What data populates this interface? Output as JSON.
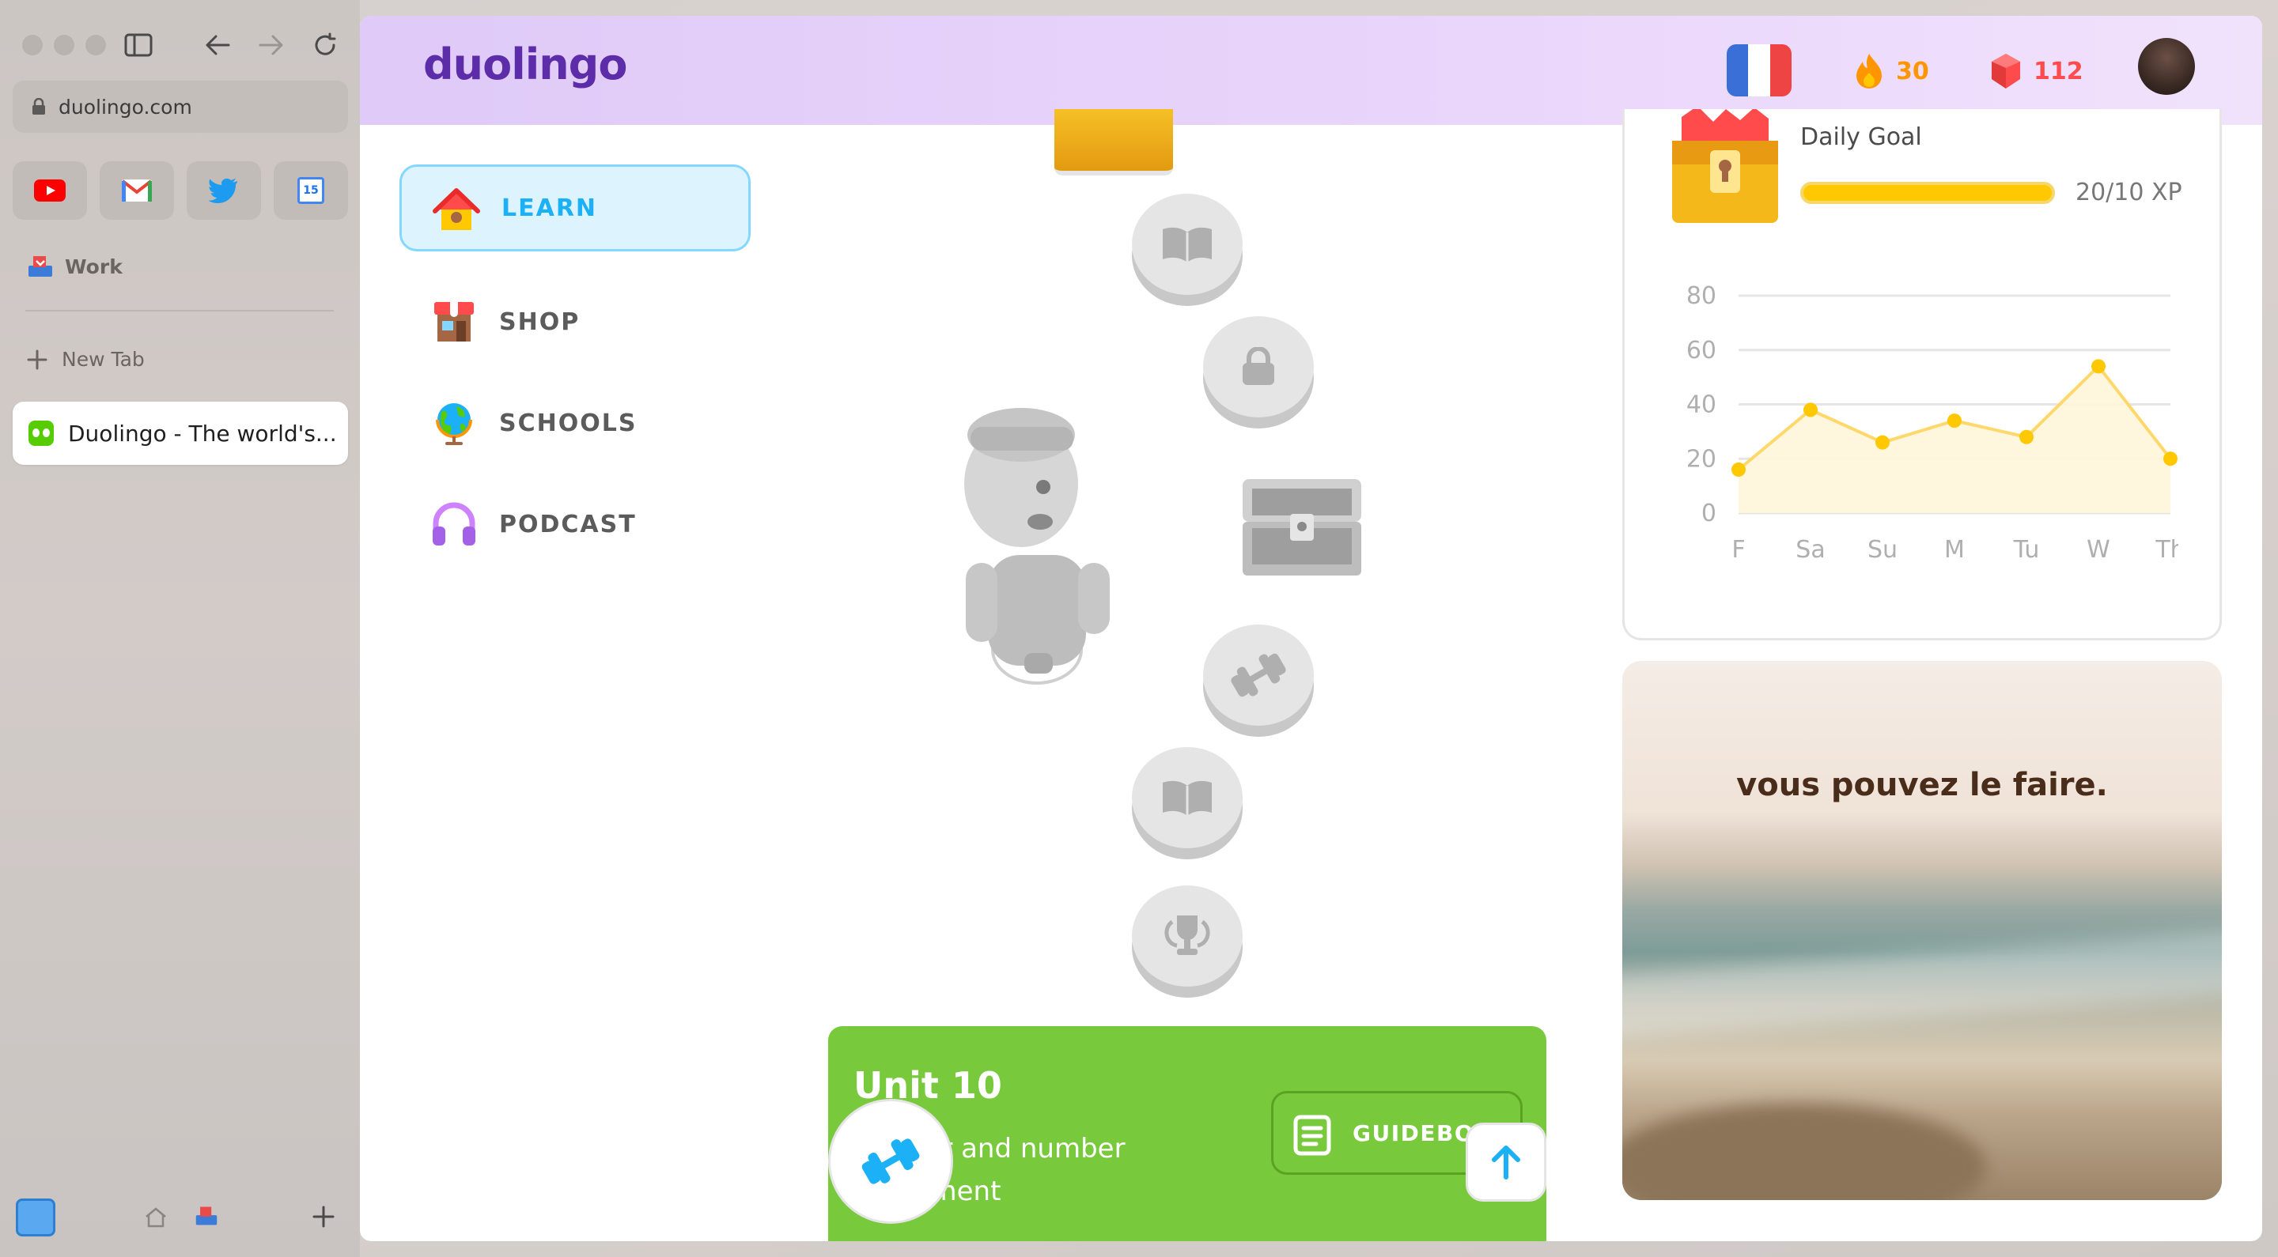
{
  "browser": {
    "url": "duolingo.com",
    "favorites": [
      "youtube-icon",
      "gmail-icon",
      "twitter-icon",
      "calendar-icon"
    ],
    "space_label": "Work",
    "new_tab_label": "New Tab",
    "active_tab_title": "Duolingo - The world's...",
    "calendar_date": "15"
  },
  "header": {
    "logo": "duolingo",
    "streak": "30",
    "gems": "112"
  },
  "nav": {
    "items": [
      {
        "label": "LEARN"
      },
      {
        "label": "SHOP"
      },
      {
        "label": "SCHOOLS"
      },
      {
        "label": "PODCAST"
      }
    ]
  },
  "unit": {
    "title": "Unit 10",
    "description": "Gender and number agreement",
    "guidebook_label": "GUIDEBOOK"
  },
  "daily_goal": {
    "label": "Daily Goal",
    "progress_text": "20/10 XP",
    "progress": 1.0
  },
  "chart_data": {
    "type": "area",
    "categories": [
      "F",
      "Sa",
      "Su",
      "M",
      "Tu",
      "W",
      "Th"
    ],
    "values": [
      16,
      38,
      26,
      34,
      28,
      54,
      20
    ],
    "ylim": [
      0,
      80
    ],
    "yticks": [
      0,
      20,
      40,
      60,
      80
    ],
    "grid": true,
    "color": "#ffc800"
  },
  "motivation": {
    "quote": "vous pouvez le faire."
  },
  "colors": {
    "learn_accent": "#1cb0f6",
    "streak": "#ff9600",
    "gems": "#ff4b4b",
    "unit_green": "#78c93c",
    "logo_purple": "#5d2ca8"
  }
}
